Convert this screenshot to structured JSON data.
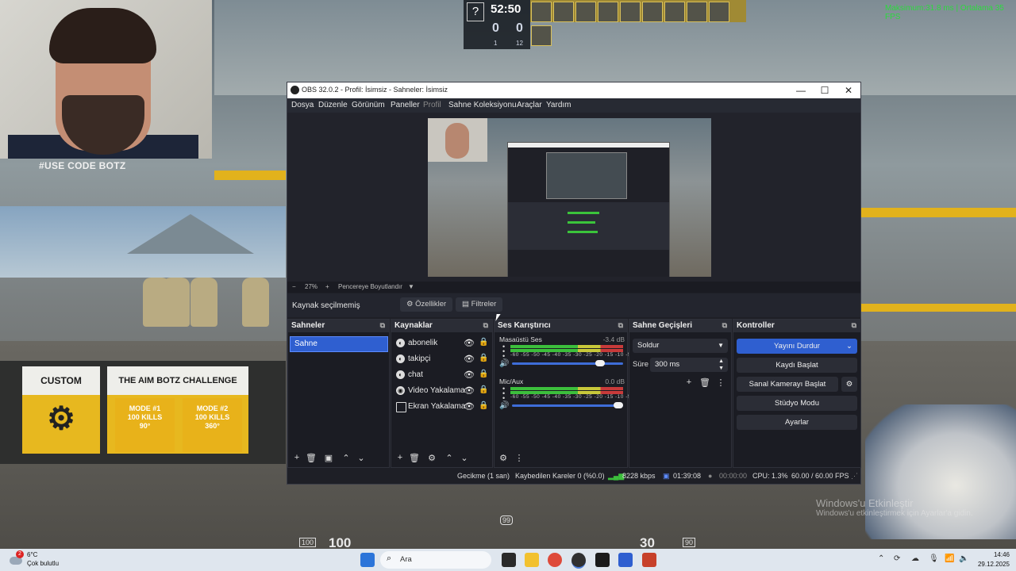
{
  "webcam": {
    "caption": "#USE CODE BOTZ"
  },
  "hud": {
    "question": "?",
    "time": "52:50",
    "score_ct": "0",
    "score_t": "0",
    "alive_ct": "1",
    "alive_t": "12",
    "fps_text": "Maksimum:31.8 ms | Ortalama 35 FPS",
    "health": "100",
    "ammo": "30",
    "reserve": "90",
    "hp_label": "100",
    "armor": "99"
  },
  "game_signs": {
    "custom": "CUSTOM",
    "challenge": "THE AIM BOTZ CHALLENGE",
    "mode1": "MODE #1\n100 KILLS\n90°",
    "mode2": "MODE #2\n100 KILLS\n360°"
  },
  "watermark": {
    "line1": "Windows'u Etkinleştir",
    "line2": "Windows'u etkinleştirmek için Ayarlar'a gidin."
  },
  "obs": {
    "title": "OBS 32.0.2 - Profil: İsimsiz - Sahneler: İsimsiz",
    "window_buttons": {
      "minimize": "—",
      "maximize": "☐",
      "close": "✕"
    },
    "menu": [
      "Dosya",
      "Düzenle",
      "Görünüm",
      "Paneller",
      "Profil",
      "Sahne Koleksiyonu",
      "Araçlar",
      "Yardım"
    ],
    "zoom": {
      "minus": "−",
      "value": "27%",
      "plus": "+",
      "fit": "Pencereye Boyutlandır",
      "arrow": "▼"
    },
    "context": {
      "no_source": "Kaynak seçilmemiş",
      "properties": "Özellikler",
      "filters": "Filtreler"
    },
    "docks": {
      "scenes": {
        "title": "Sahneler",
        "items": [
          "Sahne"
        ]
      },
      "sources": {
        "title": "Kaynaklar",
        "items": [
          {
            "name": "abonelik",
            "icon": "browser-icon"
          },
          {
            "name": "takipçi",
            "icon": "browser-icon"
          },
          {
            "name": "chat",
            "icon": "browser-icon"
          },
          {
            "name": "Video Yakalama",
            "icon": "camera-icon"
          },
          {
            "name": "Ekran Yakalama",
            "icon": "monitor-icon"
          }
        ]
      },
      "mixer": {
        "title": "Ses Karıştırıcı",
        "channels": [
          {
            "name": "Masaüstü Ses",
            "db": "-3.4 dB",
            "volume": 0.8
          },
          {
            "name": "Mic/Aux",
            "db": "0.0 dB",
            "volume": 1.0
          }
        ],
        "scale": "-60 -55 -50 -45 -40 -35 -30 -25 -20 -15 -10  -5  0"
      },
      "transitions": {
        "title": "Sahne Geçişleri",
        "type": "Soldur",
        "duration_label": "Süre",
        "duration": "300 ms"
      },
      "controls": {
        "title": "Kontroller",
        "stop_stream": "Yayını Durdur",
        "start_record": "Kaydı Başlat",
        "virtual_cam": "Sanal Kamerayı Başlat",
        "studio": "Stüdyo Modu",
        "settings": "Ayarlar"
      }
    },
    "status": {
      "delay": "Gecikme (1 san)",
      "dropped": "Kaybedilen Kareler 0 (%0.0)",
      "bitrate": "8228 kbps",
      "stream_time": "01:39:08",
      "record_time": "00:00:00",
      "cpu": "CPU: 1.3%",
      "fps": "60.00 / 60.00 FPS"
    }
  },
  "taskbar": {
    "temp": "6°C",
    "condition": "Çok bulutlu",
    "badge": "2",
    "search_placeholder": "Ara",
    "time": "14:46",
    "date": "29.12.2025"
  }
}
